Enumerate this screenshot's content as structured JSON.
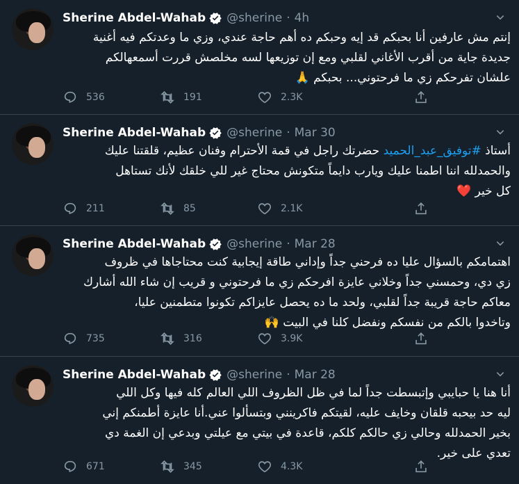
{
  "colors": {
    "background": "#15202b",
    "divider": "#38444d",
    "secondary_text": "#8899a6",
    "link": "#1da1f2",
    "verified": "#ffffff"
  },
  "tweets": [
    {
      "name": "Sherine Abdel-Wahab",
      "handle": "@sherine",
      "separator": "·",
      "time": "4h",
      "lines": [
        "إنتم مش عارفين أنا بحبكم قد إيه وحبكم ده أهم حاجة عندي، وزي ما وعدتكم فيه أغنية",
        "جديدة جاية من أقرب الأغاني لقلبي ومع إن توزيعها لسه مخلصش قررت أسمعهالكم",
        "علشان تفرحكم زي ما فرحتوني... بحبكم 🙏"
      ],
      "reply_count": "536",
      "retweet_count": "191",
      "like_count": "2.3K"
    },
    {
      "name": "Sherine Abdel-Wahab",
      "handle": "@sherine",
      "separator": "·",
      "time": "Mar 30",
      "line1_before": "أستاذ ",
      "hashtag": "#توفيق_عبد_الحميد",
      "line1_after": " حضرتك راجل في قمة الأحترام وفنان عظيم، قلقتنا عليك",
      "lines_rest": [
        "والحمدلله اننا اطمنا عليك ويارب دايماً متكونش محتاج غير للي خلقك لأنك تستاهل",
        "كل خير ❤️"
      ],
      "reply_count": "211",
      "retweet_count": "85",
      "like_count": "2.1K"
    },
    {
      "name": "Sherine Abdel-Wahab",
      "handle": "@sherine",
      "separator": "·",
      "time": "Mar 28",
      "lines": [
        "اهتمامكم بالسؤال عليا ده فرحني جداً وإداني طاقة إيجابية كنت محتاجاها في ظروف",
        "زي دي، وحمسني جداً وخلاني عايزة افرحكم زي ما فرحتوني و قريب إن شاء الله أشارك",
        "معاكم حاجة قريبة جداً لقلبي، ولحد ما ده يحصل عايزاكم تكونوا متطمنين عليا،",
        "وتاخدوا بالكم من نفسكم ونفضل كلنا في البيت 🙌"
      ],
      "reply_count": "735",
      "retweet_count": "316",
      "like_count": "3.9K"
    },
    {
      "name": "Sherine Abdel-Wahab",
      "handle": "@sherine",
      "separator": "·",
      "time": "Mar 28",
      "lines": [
        "أنا هنا يا حبايبي وإتبسطت جداً لما في ظل الظروف اللي العالم كله فيها وكل اللي",
        "ليه حد بيحبه قلقان وخايف عليه، لقيتكم فاكرينني وبتسألوا عني.أنا عايزة أطمنكم إني",
        "بخير الحمدلله وحالي زي حالكم كلكم، قاعدة في بيتي مع عيلتي وبدعي إن الغمة دي",
        "تعدي على خير."
      ],
      "reply_count": "671",
      "retweet_count": "345",
      "like_count": "4.3K"
    }
  ]
}
